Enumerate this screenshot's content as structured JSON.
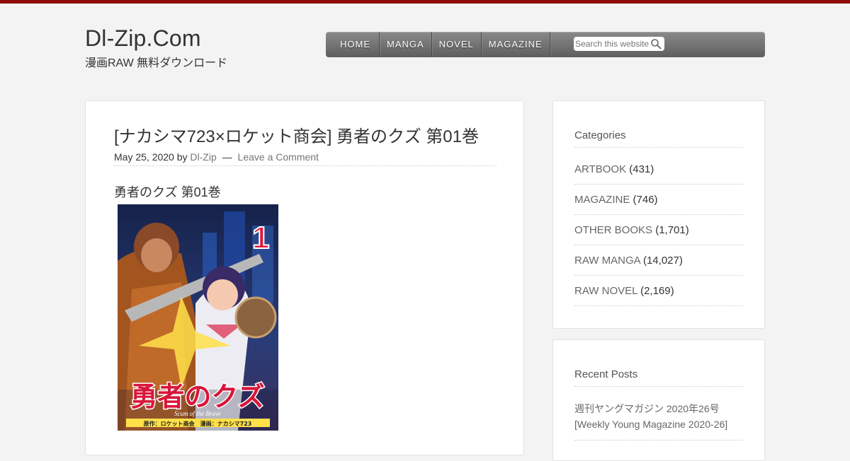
{
  "site": {
    "title": "Dl-Zip.Com",
    "description": "漫画RAW 無料ダウンロード",
    "accent_color": "#8e0a0a"
  },
  "nav": {
    "items": [
      "HOME",
      "MANGA",
      "NOVEL",
      "MAGAZINE"
    ],
    "search_placeholder": "Search this website",
    "search_icon": "magnifier-icon"
  },
  "post": {
    "title": "[ナカシマ723×ロケット商会] 勇者のクズ 第01巻",
    "date": "May 25, 2020",
    "by": "by",
    "author": "Dl-Zip",
    "separator": "—",
    "comment_link": "Leave a Comment",
    "subtitle": "勇者のクズ 第01巻",
    "cover": {
      "volume_number": "1",
      "logo_text": "勇者のクズ",
      "logo_subtitle": "Scum of the Brave",
      "credits": "原作：ロケット商会　漫画：ナカシマ723"
    }
  },
  "sidebar": {
    "categories": {
      "title": "Categories",
      "items": [
        {
          "name": "ARTBOOK",
          "count": "(431)"
        },
        {
          "name": "MAGAZINE",
          "count": "(746)"
        },
        {
          "name": "OTHER BOOKS",
          "count": "(1,701)"
        },
        {
          "name": "RAW MANGA",
          "count": "(14,027)"
        },
        {
          "name": "RAW NOVEL",
          "count": "(2,169)"
        }
      ]
    },
    "recent_posts": {
      "title": "Recent Posts",
      "items": [
        {
          "line1": "週刊ヤングマガジン 2020年26号",
          "line2": "[Weekly Young Magazine 2020-26]"
        }
      ]
    }
  }
}
